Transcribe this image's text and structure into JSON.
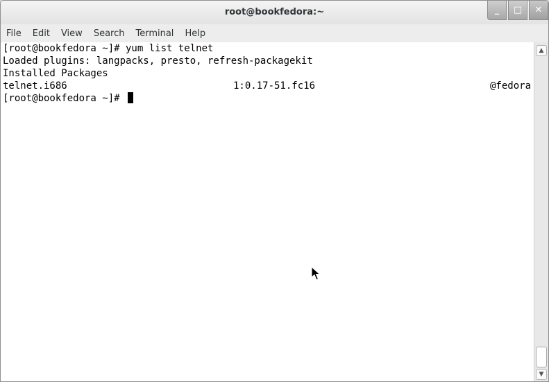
{
  "window": {
    "title": "root@bookfedora:~",
    "buttons": {
      "minimize": "_",
      "maximize": "□",
      "close": "✕"
    }
  },
  "menubar": {
    "items": [
      {
        "label": "File"
      },
      {
        "label": "Edit"
      },
      {
        "label": "View"
      },
      {
        "label": "Search"
      },
      {
        "label": "Terminal"
      },
      {
        "label": "Help"
      }
    ]
  },
  "terminal": {
    "lines": [
      {
        "text": "[root@bookfedora ~]# yum list telnet"
      },
      {
        "text": "Loaded plugins: langpacks, presto, refresh-packagekit"
      },
      {
        "text": "Installed Packages"
      }
    ],
    "package_row": {
      "name": "telnet.i686",
      "version": "1:0.17-51.fc16",
      "repo": "@fedora"
    },
    "prompt": "[root@bookfedora ~]# "
  },
  "scrollbar": {
    "up_arrow": "▲",
    "down_arrow": "▼",
    "position": 1.0
  }
}
